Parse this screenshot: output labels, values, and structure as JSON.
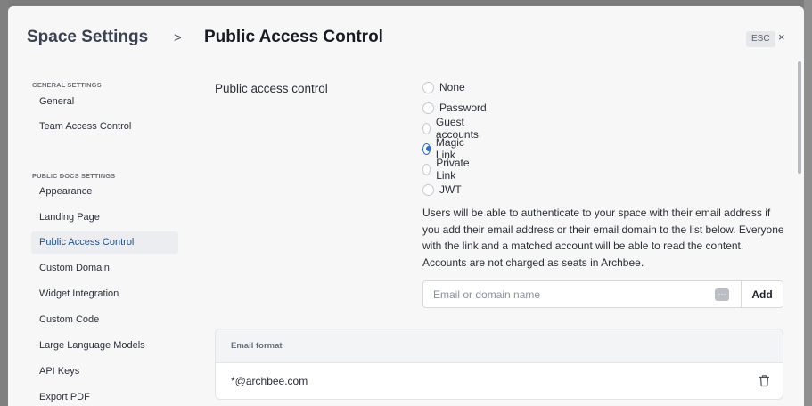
{
  "header": {
    "space_title": "Space Settings",
    "separator": ">",
    "page_title": "Public Access Control",
    "esc_label": "ESC",
    "close_glyph": "×"
  },
  "sidebar": {
    "general_section": "GENERAL SETTINGS",
    "general_items": [
      {
        "label": "General",
        "active": false
      },
      {
        "label": "Team Access Control",
        "active": false
      }
    ],
    "docs_section": "PUBLIC DOCS SETTINGS",
    "docs_items": [
      {
        "label": "Appearance",
        "active": false
      },
      {
        "label": "Landing Page",
        "active": false
      },
      {
        "label": "Public Access Control",
        "active": true
      },
      {
        "label": "Custom Domain",
        "active": false
      },
      {
        "label": "Widget Integration",
        "active": false
      },
      {
        "label": "Custom Code",
        "active": false
      },
      {
        "label": "Large Language Models",
        "active": false
      },
      {
        "label": "API Keys",
        "active": false
      },
      {
        "label": "Export PDF",
        "active": false
      }
    ]
  },
  "access": {
    "field_label": "Public access control",
    "options": [
      {
        "label": "None",
        "checked": false
      },
      {
        "label": "Password",
        "checked": false
      },
      {
        "label": "Guest accounts",
        "checked": false
      },
      {
        "label": "Magic Link",
        "checked": true
      },
      {
        "label": "Private Link",
        "checked": false
      },
      {
        "label": "JWT",
        "checked": false
      }
    ],
    "help_text": "Users will be able to authenticate to your space with their email address if you add their email address or their email domain to the list below. Everyone with the link and a matched account will be able to read the content. Accounts are not charged as seats in Archbee."
  },
  "email_input": {
    "placeholder": "Email or domain name",
    "value": "",
    "add_label": "Add",
    "dots_glyph": "···"
  },
  "email_table": {
    "header": "Email format",
    "rows": [
      "*@archbee.com"
    ]
  },
  "colors": {
    "accent": "#2f6ccf",
    "active_nav_bg": "#ecedf0",
    "active_nav_text": "#1f4f8f",
    "modal_bg": "#f7f7f8"
  },
  "icons": {
    "close": "close-icon",
    "more": "more-dots-icon",
    "delete": "trash-icon"
  }
}
